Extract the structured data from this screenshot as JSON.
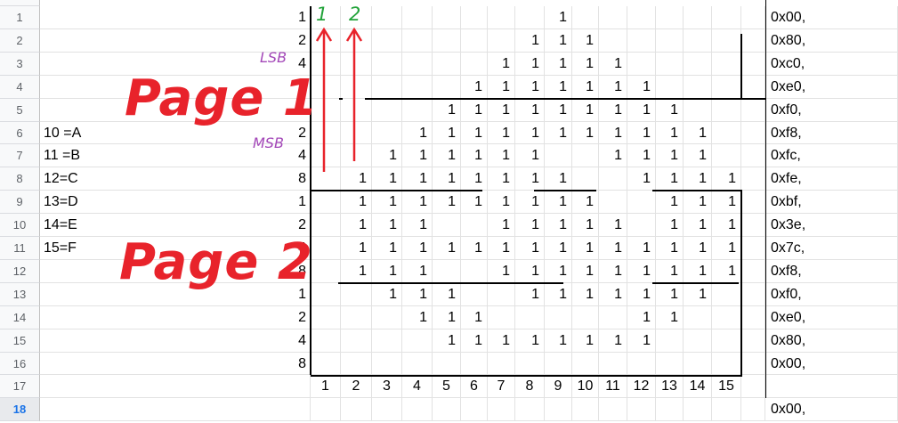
{
  "rows": [
    "1",
    "2",
    "3",
    "4",
    "5",
    "6",
    "7",
    "8",
    "9",
    "10",
    "11",
    "12",
    "13",
    "14",
    "15",
    "16",
    "17",
    "18"
  ],
  "selected_row": "18",
  "legend": [
    "10 =A",
    "11 =B",
    "12=C",
    "13=D",
    "14=E",
    "15=F"
  ],
  "row_labels": [
    "1",
    "2",
    "4",
    "8",
    "1",
    "2",
    "4",
    "8",
    "1",
    "2",
    "4",
    "8",
    "1",
    "2",
    "4",
    "8"
  ],
  "hex_values": [
    "0x00,",
    "0x80,",
    "0xc0,",
    "0xe0,",
    "0xf0,",
    "0xf8,",
    "0xfc,",
    "0xfe,",
    "0xbf,",
    "0x3e,",
    "0x7c,",
    "0xf8,",
    "0xf0,",
    "0xe0,",
    "0x80,",
    "0x00,"
  ],
  "hex_row18": "0x00,",
  "column_numbers": [
    "1",
    "2",
    "3",
    "4",
    "5",
    "6",
    "7",
    "8",
    "9",
    "10",
    "11",
    "12",
    "13",
    "14",
    "15"
  ],
  "grid": [
    [
      0,
      0,
      0,
      0,
      0,
      0,
      0,
      0,
      1,
      0,
      0,
      0,
      0,
      0,
      0
    ],
    [
      0,
      0,
      0,
      0,
      0,
      0,
      0,
      1,
      1,
      1,
      0,
      0,
      0,
      0,
      0
    ],
    [
      0,
      0,
      0,
      0,
      0,
      0,
      1,
      1,
      1,
      1,
      1,
      0,
      0,
      0,
      0
    ],
    [
      0,
      0,
      0,
      0,
      0,
      1,
      1,
      1,
      1,
      1,
      1,
      1,
      0,
      0,
      0
    ],
    [
      0,
      0,
      0,
      0,
      1,
      1,
      1,
      1,
      1,
      1,
      1,
      1,
      1,
      0,
      0
    ],
    [
      0,
      0,
      0,
      1,
      1,
      1,
      1,
      1,
      1,
      1,
      1,
      1,
      1,
      1,
      0
    ],
    [
      0,
      0,
      1,
      1,
      1,
      1,
      1,
      1,
      0,
      0,
      1,
      1,
      1,
      1,
      0
    ],
    [
      0,
      1,
      1,
      1,
      1,
      1,
      1,
      1,
      1,
      0,
      0,
      1,
      1,
      1,
      1
    ],
    [
      0,
      1,
      1,
      1,
      1,
      1,
      1,
      1,
      1,
      1,
      0,
      0,
      1,
      1,
      1
    ],
    [
      0,
      1,
      1,
      1,
      0,
      0,
      1,
      1,
      1,
      1,
      1,
      0,
      1,
      1,
      1
    ],
    [
      0,
      1,
      1,
      1,
      1,
      1,
      1,
      1,
      1,
      1,
      1,
      1,
      1,
      1,
      1
    ],
    [
      0,
      1,
      1,
      1,
      0,
      0,
      1,
      1,
      1,
      1,
      1,
      1,
      1,
      1,
      1
    ],
    [
      0,
      0,
      1,
      1,
      1,
      0,
      0,
      1,
      1,
      1,
      1,
      1,
      1,
      1,
      0
    ],
    [
      0,
      0,
      0,
      1,
      1,
      1,
      0,
      0,
      0,
      0,
      0,
      1,
      1,
      0,
      0
    ],
    [
      0,
      0,
      0,
      0,
      1,
      1,
      1,
      1,
      1,
      1,
      1,
      1,
      0,
      0,
      0
    ],
    [
      0,
      0,
      0,
      0,
      0,
      0,
      0,
      0,
      0,
      0,
      0,
      0,
      0,
      0,
      0
    ]
  ],
  "overlays": {
    "page1": "Page 1",
    "page2": "Page 2",
    "lsb": "LSB",
    "msb": "MSB",
    "col1": "1",
    "col2": "2"
  },
  "colors": {
    "page": "#e8232b",
    "bits": "#a347b8",
    "green": "#22a33a",
    "arrow": "#e8232b"
  }
}
